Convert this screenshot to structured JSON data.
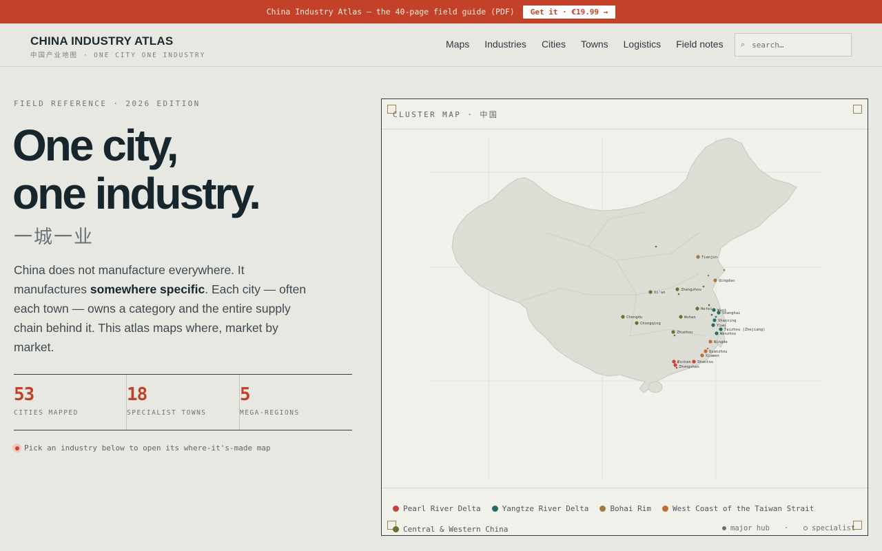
{
  "promo": {
    "text": "China Industry Atlas — the 40-page field guide (PDF)",
    "button": "Get it · €19.99 →"
  },
  "brand": {
    "title": "CHINA INDUSTRY ATLAS",
    "subtitle": "中国产业地图 · ONE CITY ONE INDUSTRY"
  },
  "nav": [
    "Maps",
    "Industries",
    "Cities",
    "Towns",
    "Logistics",
    "Field notes"
  ],
  "search": {
    "placeholder": "search…"
  },
  "hero": {
    "eyebrow": "FIELD REFERENCE · 2026 EDITION",
    "headline_line1": "One city,",
    "headline_line2": "one industry.",
    "headline_cn": "一城一业",
    "intro_pre": "China does not manufacture everywhere. It manufactures ",
    "intro_bold": "somewhere specific",
    "intro_post": ". Each city — often each town — owns a category and the entire supply chain behind it. This atlas maps where, market by market."
  },
  "stats": [
    {
      "value": "53",
      "label": "CITIES MAPPED"
    },
    {
      "value": "18",
      "label": "SPECIALIST TOWNS"
    },
    {
      "value": "5",
      "label": "MEGA-REGIONS"
    }
  ],
  "hint": "Pick an industry below to open its where-it's-made map",
  "map": {
    "label": "CLUSTER MAP · 中国",
    "cities": [
      {
        "name": "Tianjin",
        "region": "bohai"
      },
      {
        "name": "Qingdao",
        "region": "bohai"
      },
      {
        "name": "Zhengzhou",
        "region": "central"
      },
      {
        "name": "Xi'an",
        "region": "central"
      },
      {
        "name": "Hefei",
        "region": "central"
      },
      {
        "name": "Wuxi",
        "region": "yangtze"
      },
      {
        "name": "Shanghai",
        "region": "yangtze"
      },
      {
        "name": "Shaoxing",
        "region": "yangtze"
      },
      {
        "name": "Yiwu",
        "region": "yangtze"
      },
      {
        "name": "Taizhou (Zhejiang)",
        "region": "yangtze"
      },
      {
        "name": "Wenzhou",
        "region": "yangtze"
      },
      {
        "name": "Wuhan",
        "region": "central"
      },
      {
        "name": "Chengdu",
        "region": "central"
      },
      {
        "name": "Chongqing",
        "region": "central"
      },
      {
        "name": "Zhuzhou",
        "region": "central"
      },
      {
        "name": "Ningde",
        "region": "taiwan_strait"
      },
      {
        "name": "Quanzhou",
        "region": "taiwan_strait"
      },
      {
        "name": "Xiamen",
        "region": "taiwan_strait"
      },
      {
        "name": "Shantou",
        "region": "pearl"
      },
      {
        "name": "Zhongshan",
        "region": "pearl"
      },
      {
        "name": "Foshan",
        "region": "pearl"
      }
    ]
  },
  "legend": {
    "regions": [
      {
        "name": "Pearl River Delta",
        "color": "#c8413a"
      },
      {
        "name": "Yangtze River Delta",
        "color": "#2a6a64"
      },
      {
        "name": "Bohai Rim",
        "color": "#a07a42"
      },
      {
        "name": "West Coast of the Taiwan Strait",
        "color": "#c36a34"
      },
      {
        "name": "Central & Western China",
        "color": "#6b6f32"
      }
    ],
    "major_hub": "major hub",
    "specialist": "specialist",
    "separator": "·"
  }
}
